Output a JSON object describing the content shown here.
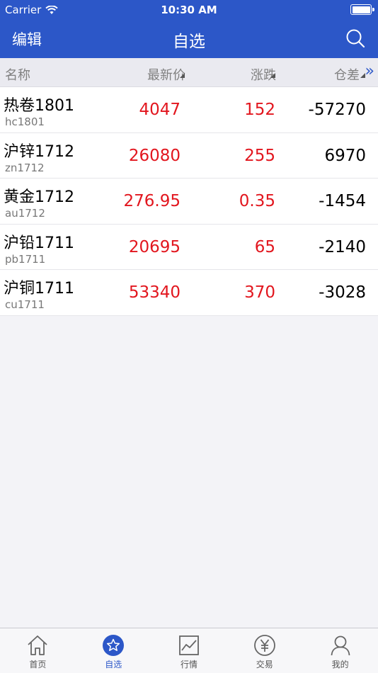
{
  "status": {
    "carrier": "Carrier",
    "time": "10:30 AM"
  },
  "nav": {
    "edit_label": "编辑",
    "title": "自选"
  },
  "columns": {
    "name": "名称",
    "price": "最新价",
    "change": "涨跌",
    "oi": "仓差"
  },
  "rows": [
    {
      "name": "热卷1801",
      "code": "hc1801",
      "price": "4047",
      "change": "152",
      "oi": "-57270"
    },
    {
      "name": "沪锌1712",
      "code": "zn1712",
      "price": "26080",
      "change": "255",
      "oi": "6970"
    },
    {
      "name": "黄金1712",
      "code": "au1712",
      "price": "276.95",
      "change": "0.35",
      "oi": "-1454"
    },
    {
      "name": "沪铅1711",
      "code": "pb1711",
      "price": "20695",
      "change": "65",
      "oi": "-2140"
    },
    {
      "name": "沪铜1711",
      "code": "cu1711",
      "price": "53340",
      "change": "370",
      "oi": "-3028"
    }
  ],
  "tabs": [
    {
      "label": "首页",
      "icon": "home-icon"
    },
    {
      "label": "自选",
      "icon": "star-icon",
      "active": true
    },
    {
      "label": "行情",
      "icon": "chart-icon"
    },
    {
      "label": "交易",
      "icon": "yen-icon"
    },
    {
      "label": "我的",
      "icon": "user-icon"
    }
  ],
  "colors": {
    "brand": "#2c57c8",
    "up": "#e2161e"
  }
}
